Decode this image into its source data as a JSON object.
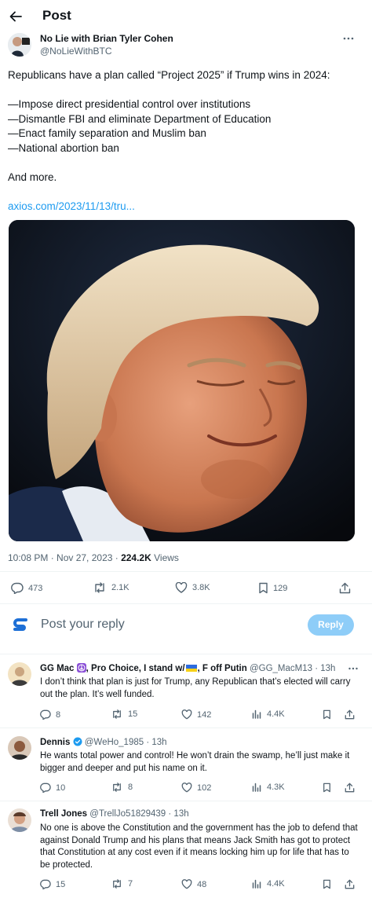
{
  "header": {
    "title": "Post"
  },
  "post": {
    "author_name": "No Lie with Brian Tyler Cohen",
    "author_handle": "@NoLieWithBTC",
    "text": "Republicans have a plan called “Project 2025” if Trump wins in 2024:\n\n—Impose direct presidential control over institutions\n—Dismantle FBI and eliminate Department of Education\n—Enact family separation and Muslim ban\n—National abortion ban\n\nAnd more.",
    "link": "axios.com/2023/11/13/tru...",
    "time": "10:08 PM · Nov 27, 2023 · ",
    "views_count": "224.2K",
    "views_label": " Views",
    "stats": {
      "replies": "473",
      "reposts": "2.1K",
      "likes": "3.8K",
      "bookmarks": "129"
    }
  },
  "reply_box": {
    "placeholder": "Post your reply",
    "button": "Reply"
  },
  "replies": [
    {
      "name_a": "GG Mac ",
      "name_b": ", Pro Choice, I stand w/",
      "name_c": ", F off Putin",
      "handle_time": " @GG_MacM13 · 13h",
      "text": "I don’t think that plan is just for Trump, any Republican that’s elected will carry out the plan. It’s well funded.",
      "replies": "8",
      "reposts": "15",
      "likes": "142",
      "views": "4.4K"
    },
    {
      "name": "Dennis",
      "handle_time": " @WeHo_1985 · 13h",
      "text": "He wants total power and control! He won’t drain the swamp, he’ll just make it bigger and deeper and put his name on it.",
      "replies": "10",
      "reposts": "8",
      "likes": "102",
      "views": "4.3K"
    },
    {
      "name": "Trell Jones",
      "handle_time": " @TrellJo51829439 · 13h",
      "text": "No one is above the Constitution and the government has the job to defend that against Donald Trump and his plans that means Jack Smith has got to protect that Constitution at any cost even if it means locking him up for life that has to be protected.",
      "replies": "15",
      "reposts": "7",
      "likes": "48",
      "views": "4.4K"
    }
  ],
  "colors": {
    "link": "#1d9bf0",
    "reply_button": "#8ecdf8",
    "muted": "#536471",
    "text": "#0f1419"
  },
  "icons": [
    "back-arrow-icon",
    "more-icon",
    "reply-icon",
    "repost-icon",
    "like-icon",
    "bookmark-icon",
    "share-icon",
    "views-icon",
    "verified-badge-icon"
  ]
}
